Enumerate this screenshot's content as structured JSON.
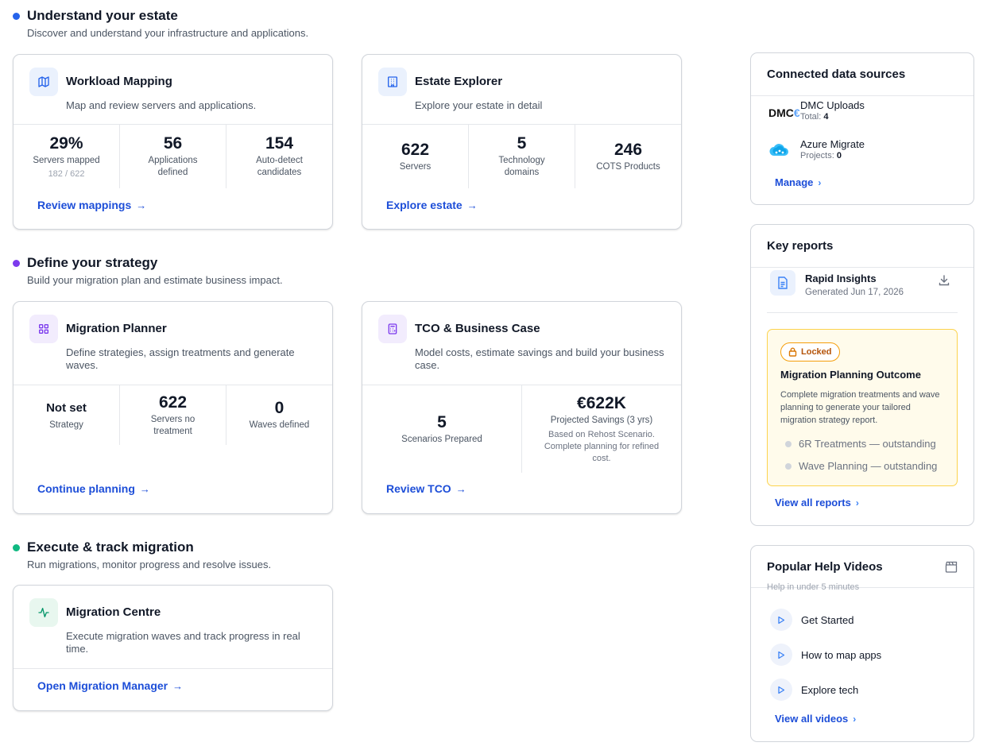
{
  "sections": {
    "understand": {
      "title": "Understand your estate",
      "subtitle": "Discover and understand your infrastructure and applications.",
      "color": "#2563eb"
    },
    "define": {
      "title": "Define your strategy",
      "subtitle": "Build your migration plan and estimate business impact.",
      "color": "#7c3aed"
    },
    "execute": {
      "title": "Execute & track migration",
      "subtitle": "Run migrations, monitor progress and resolve issues.",
      "color": "#10b981"
    }
  },
  "cards": {
    "workload": {
      "title": "Workload Mapping",
      "desc": "Map and review servers and applications.",
      "icon": "map-icon",
      "stats": [
        {
          "value": "29%",
          "label": "Servers mapped",
          "sub": "182 / 622"
        },
        {
          "value": "56",
          "label": "Applications defined"
        },
        {
          "value": "154",
          "label": "Auto-detect candidates"
        }
      ],
      "link": "Review mappings"
    },
    "estate": {
      "title": "Estate Explorer",
      "desc": "Explore your estate in detail",
      "icon": "building-icon",
      "stats": [
        {
          "value": "622",
          "label": "Servers"
        },
        {
          "value": "5",
          "label": "Technology domains"
        },
        {
          "value": "246",
          "label": "COTS Products"
        }
      ],
      "link": "Explore estate"
    },
    "planner": {
      "title": "Migration Planner",
      "desc": "Define strategies, assign treatments and generate waves.",
      "icon": "grid-icon",
      "stats": [
        {
          "value": "Not set",
          "label": "Strategy"
        },
        {
          "value": "622",
          "label": "Servers no treatment"
        },
        {
          "value": "0",
          "label": "Waves defined"
        }
      ],
      "link": "Continue planning"
    },
    "tco": {
      "title": "TCO & Business Case",
      "desc": "Model costs, estimate savings and build your business case.",
      "icon": "calculator-icon",
      "stats": [
        {
          "value": "5",
          "label": "Scenarios Prepared"
        },
        {
          "value": "€622K",
          "label": "Projected Savings (3 yrs)",
          "note": "Based on Rehost Scenario. Complete planning for refined cost."
        }
      ],
      "link": "Review TCO"
    },
    "centre": {
      "title": "Migration Centre",
      "desc": "Execute migration waves and track progress in real time.",
      "icon": "activity-icon",
      "link": "Open Migration Manager"
    }
  },
  "sources": {
    "title": "Connected data sources",
    "items": [
      {
        "name": "DMC Uploads",
        "meta_label": "Total:",
        "meta_value": "4",
        "logo": "DMC"
      },
      {
        "name": "Azure Migrate",
        "meta_label": "Projects:",
        "meta_value": "0",
        "logo": "azure-cloud-icon"
      }
    ],
    "link": "Manage"
  },
  "reports": {
    "title": "Key reports",
    "item": {
      "name": "Rapid Insights",
      "date": "Generated Jun 17, 2026"
    },
    "locked": {
      "badge": "Locked",
      "title": "Migration Planning Outcome",
      "desc": "Complete migration treatments and wave planning to generate your tailored migration strategy report.",
      "items": [
        "6R Treatments — outstanding",
        "Wave Planning — outstanding"
      ]
    },
    "link": "View all reports"
  },
  "videos": {
    "title": "Popular Help Videos",
    "subtitle": "Help in under 5 minutes",
    "items": [
      "Get Started",
      "How to map apps",
      "Explore tech"
    ],
    "link": "View all videos"
  }
}
